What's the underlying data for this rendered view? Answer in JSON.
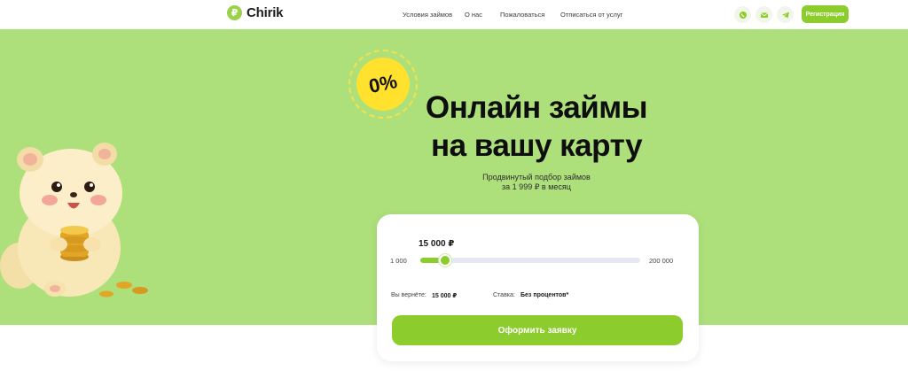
{
  "header": {
    "logo_text": "Chirik",
    "nav": [
      "Условия займов",
      "О нас",
      "Пожаловаться",
      "Отписаться от услуг"
    ],
    "social_icons": [
      "whatsapp-icon",
      "mail-icon",
      "telegram-icon"
    ],
    "register_label": "Регистрация"
  },
  "hero": {
    "badge": "0%",
    "title_line1": "Онлайн займы",
    "title_line2": "на вашу карту",
    "subtitle_line1": "Продвинутый подбор займов",
    "subtitle_line2": "за 1 999 ₽ в месяц"
  },
  "calculator": {
    "amount": "15 000 ₽",
    "min": "1 000",
    "max": "200 000",
    "slider_value": 15000,
    "slider_min": 1000,
    "slider_max": 200000,
    "return_label": "Вы вернёте:",
    "return_value": "15 000 ₽",
    "rate_label": "Ставка:",
    "rate_value": "Без процентов*",
    "apply_label": "Оформить заявку"
  },
  "colors": {
    "accent": "#8ccc2c",
    "hero_bg": "#ade07b",
    "badge": "#ffe12e"
  }
}
